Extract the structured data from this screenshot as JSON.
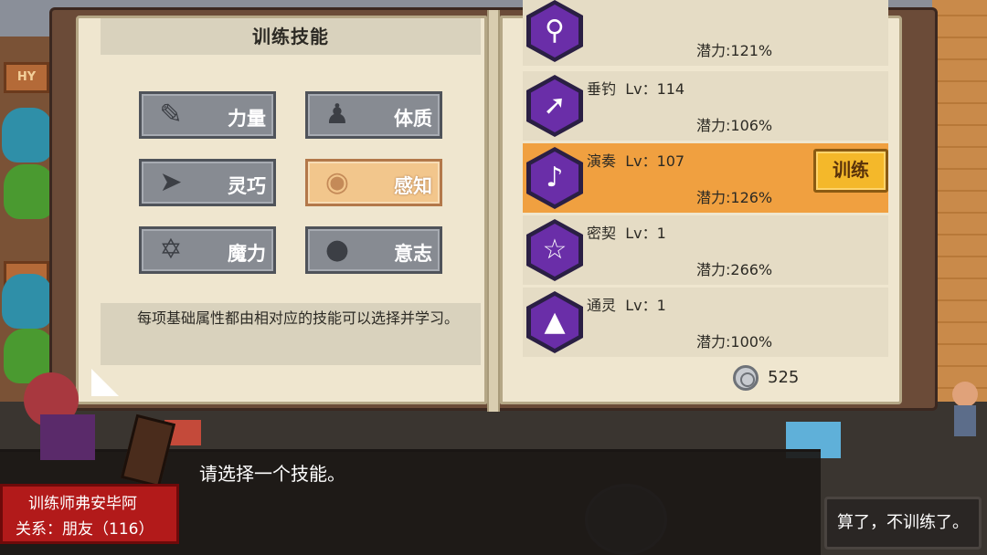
{
  "panel": {
    "title": "训练技能",
    "attributes": [
      {
        "label": "力量",
        "icon": "arm-icon"
      },
      {
        "label": "体质",
        "icon": "torso-icon"
      },
      {
        "label": "灵巧",
        "icon": "runner-icon"
      },
      {
        "label": "感知",
        "icon": "eye-icon",
        "selected": true
      },
      {
        "label": "魔力",
        "icon": "hexagram-icon"
      },
      {
        "label": "意志",
        "icon": "head-icon"
      }
    ],
    "description": "每项基础属性都由相对应的技能可以选择并学习。"
  },
  "skills": [
    {
      "name": "",
      "level": "",
      "potential": "潜力:121%",
      "icon": "magnifier-icon"
    },
    {
      "name": "垂钓",
      "level": "Lv：114",
      "potential": "潜力:106%",
      "icon": "fishing-rod-icon"
    },
    {
      "name": "演奏",
      "level": "Lv：107",
      "potential": "潜力:126%",
      "icon": "music-note-icon",
      "selected": true
    },
    {
      "name": "密契",
      "level": "Lv：1",
      "potential": "潜力:266%",
      "icon": "pentagram-icon"
    },
    {
      "name": "通灵",
      "level": "Lv：1",
      "potential": "潜力:100%",
      "icon": "triforce-icon"
    }
  ],
  "train_label": "训练",
  "currency": {
    "value": "525",
    "icon": "coin-icon"
  },
  "dialog": {
    "text": "请选择一个技能。",
    "npc_name": "训练师弗安毕阿",
    "relation": "关系：朋友（116）",
    "cancel_label": "算了，不训练了。"
  },
  "scene_sign": "HY",
  "colors": {
    "accent": "#f0a040",
    "skill_purple": "#6a2ea8",
    "button_gold": "#f4b82a",
    "name_plate": "#b21a1a"
  }
}
